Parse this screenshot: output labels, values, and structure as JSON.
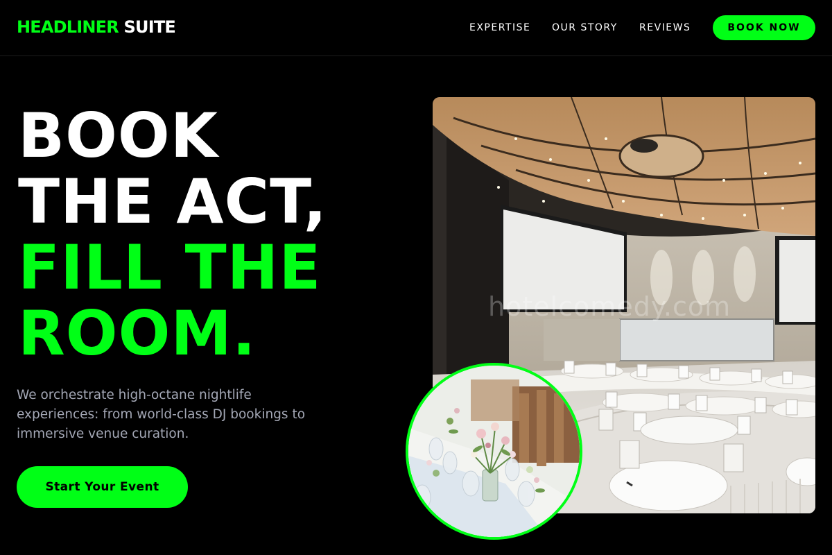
{
  "brand": {
    "part1": "HEADLINER",
    "part2": "SUITE"
  },
  "nav": {
    "links": [
      {
        "label": "EXPERTISE"
      },
      {
        "label": "OUR STORY"
      },
      {
        "label": "REVIEWS"
      }
    ],
    "cta": "BOOK NOW"
  },
  "hero": {
    "headline": {
      "line1": "BOOK",
      "line2": "THE ACT,",
      "line3": "FILL THE",
      "line4": "ROOM."
    },
    "subtext": "We orchestrate high-octane nightlife experiences: from world-class DJ bookings to immersive venue curation.",
    "cta": "Start Your Event"
  },
  "media": {
    "watermark": "hotelcomedy.com",
    "main_image": "conference-hall-photo",
    "inset_image": "table-flowers-photo"
  },
  "colors": {
    "accent": "#00ff16",
    "background": "#000000",
    "text": "#ffffff",
    "muted_text": "#a4a8b6"
  }
}
